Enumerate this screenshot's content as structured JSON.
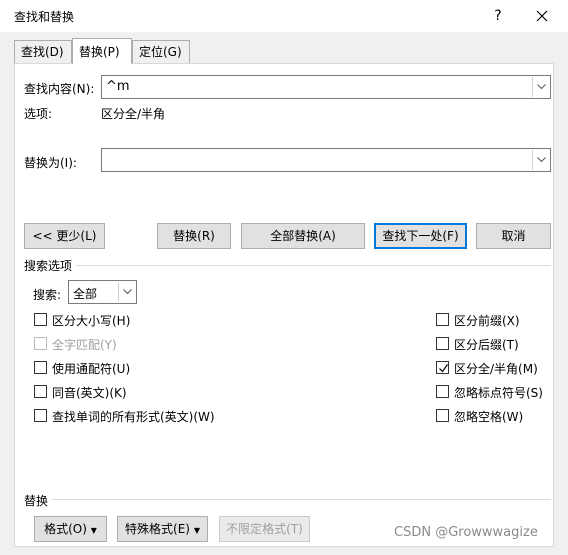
{
  "window": {
    "title": "查找和替换",
    "help": "?"
  },
  "tabs": [
    {
      "label": "查找(D)"
    },
    {
      "label": "替换(P)"
    },
    {
      "label": "定位(G)"
    }
  ],
  "find": {
    "label": "查找内容(N):",
    "value": "^m"
  },
  "options_summary": {
    "label": "选项:",
    "value": "区分全/半角"
  },
  "replace": {
    "label": "替换为(I):",
    "value": ""
  },
  "buttons": {
    "less": "<< 更少(L)",
    "replace": "替换(R)",
    "replace_all": "全部替换(A)",
    "find_next": "查找下一处(F)",
    "cancel": "取消"
  },
  "search_options": {
    "heading": "搜索选项",
    "search_label": "搜索:",
    "search_value": "全部",
    "left": [
      {
        "label": "区分大小写(H)",
        "checked": false,
        "disabled": false
      },
      {
        "label": "全字匹配(Y)",
        "checked": false,
        "disabled": true
      },
      {
        "label": "使用通配符(U)",
        "checked": false,
        "disabled": false
      },
      {
        "label": "同音(英文)(K)",
        "checked": false,
        "disabled": false
      },
      {
        "label": "查找单词的所有形式(英文)(W)",
        "checked": false,
        "disabled": false
      }
    ],
    "right": [
      {
        "label": "区分前缀(X)",
        "checked": false,
        "disabled": false
      },
      {
        "label": "区分后缀(T)",
        "checked": false,
        "disabled": false
      },
      {
        "label": "区分全/半角(M)",
        "checked": true,
        "disabled": false
      },
      {
        "label": "忽略标点符号(S)",
        "checked": false,
        "disabled": false
      },
      {
        "label": "忽略空格(W)",
        "checked": false,
        "disabled": false
      }
    ]
  },
  "replace_section": {
    "heading": "替换",
    "format": "格式(O)",
    "special": "特殊格式(E)",
    "no_format": "不限定格式(T)"
  },
  "watermark": "CSDN @Growwwagize"
}
